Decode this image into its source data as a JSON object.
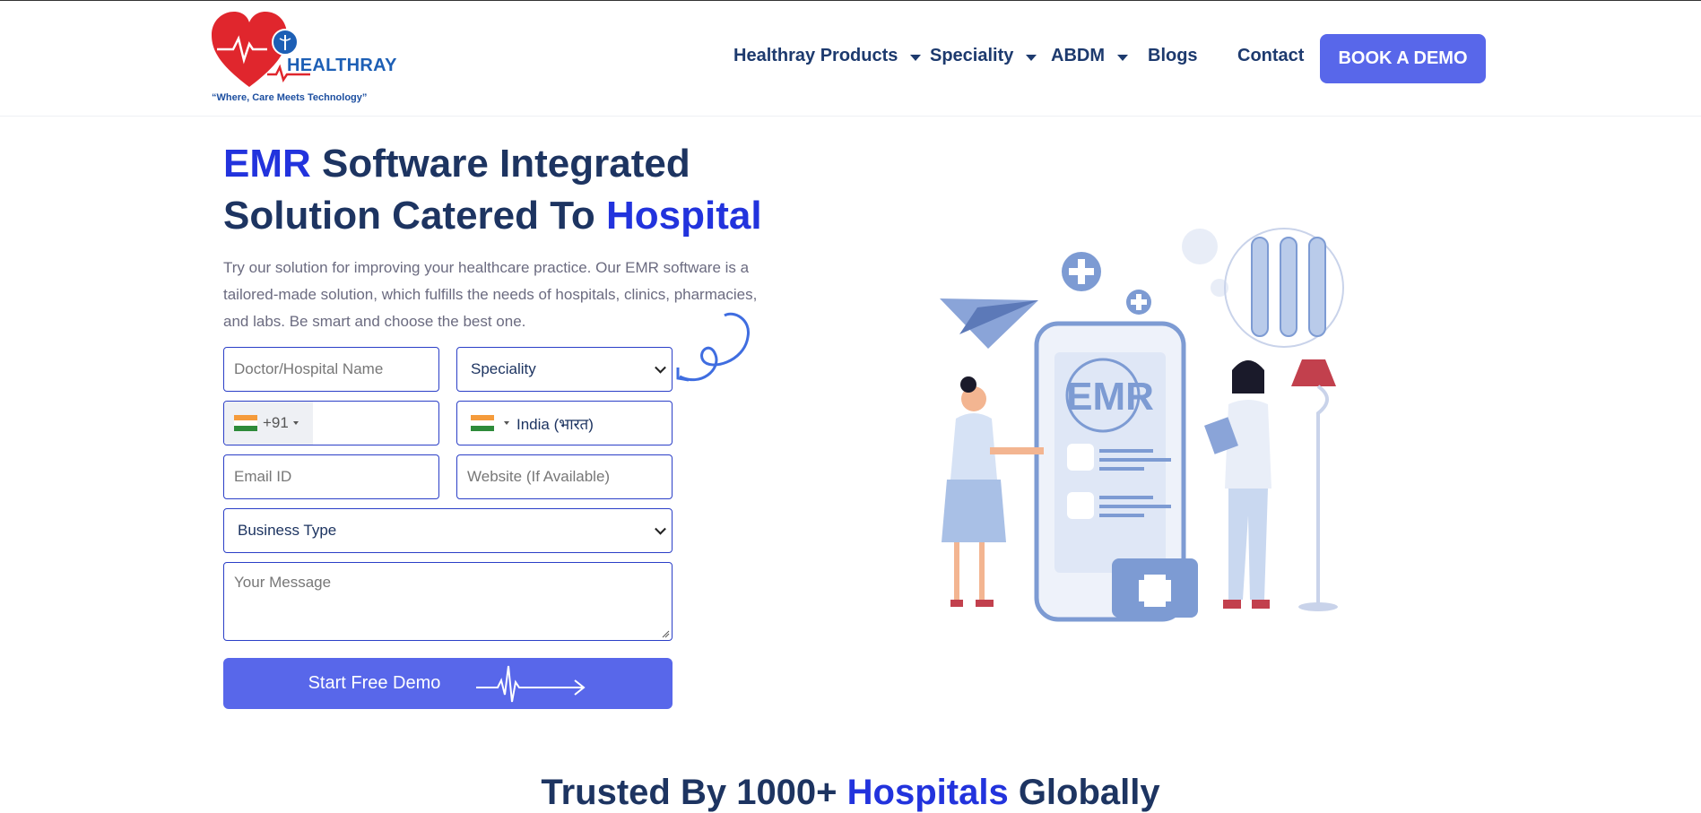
{
  "header": {
    "logo": {
      "brand": "HEALTHRAY",
      "tagline": "“Where, Care Meets Technology”"
    },
    "nav": [
      {
        "label": "Healthray Products",
        "has_dropdown": true
      },
      {
        "label": "Speciality",
        "has_dropdown": true
      },
      {
        "label": "ABDM",
        "has_dropdown": true
      },
      {
        "label": "Blogs",
        "has_dropdown": false
      },
      {
        "label": "Contact",
        "has_dropdown": false
      }
    ],
    "cta": "BOOK A DEMO"
  },
  "hero": {
    "title_line1_hl": "EMR",
    "title_line1_rest": " Software Integrated",
    "title_line2_rest": "Solution Catered To ",
    "title_line2_hl": "Hospital",
    "intro": "Try our solution for improving your healthcare practice. Our EMR software is a tailored-made solution, which fulfills the needs of hospitals, clinics, pharmacies, and labs. Be smart and choose the best one."
  },
  "form": {
    "name_placeholder": "Doctor/Hospital Name",
    "speciality_selected": "Speciality",
    "phone_dial_code": "+91",
    "country_selected": "India (भारत)",
    "email_placeholder": "Email ID",
    "website_placeholder": "Website (If Available)",
    "business_type_selected": "Business Type",
    "message_placeholder": "Your Message",
    "submit_label": "Start Free Demo"
  },
  "illustration": {
    "screen_text": "EMR"
  },
  "trusted": {
    "prefix": "Trusted By 1000+ ",
    "hl": "Hospitals",
    "suffix": " Globally"
  },
  "colors": {
    "primary": "#5867ea",
    "heading": "#1d3461",
    "highlight": "#2233dd",
    "logo_red": "#e0262d",
    "logo_blue": "#1d5fb5"
  }
}
